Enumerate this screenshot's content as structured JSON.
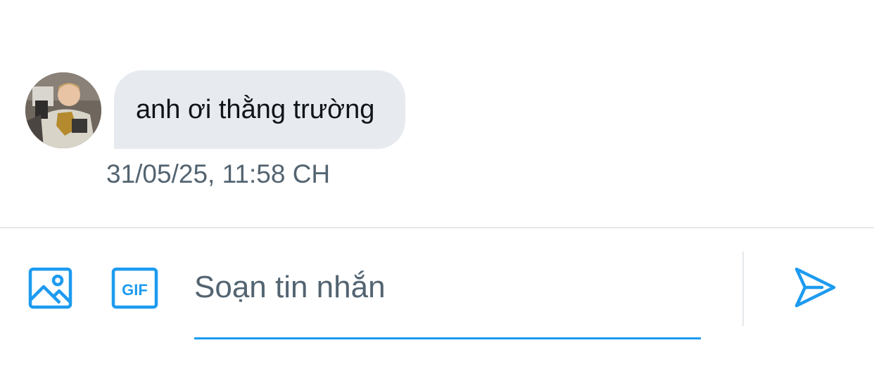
{
  "conversation": {
    "messages": [
      {
        "sender_avatar": "avatar-photo",
        "text": "anh ơi thằng trường",
        "timestamp": "31/05/25, 11:58 CH"
      }
    ]
  },
  "composer": {
    "image_button_icon": "image-icon",
    "gif_button_icon": "gif-icon",
    "gif_label": "GIF",
    "input_placeholder": "Soạn tin nhắn",
    "input_value": "",
    "send_button_icon": "send-icon"
  },
  "colors": {
    "accent": "#1d9bf0",
    "bubble_bg": "#e7ebef",
    "text_primary": "#0f1419",
    "text_secondary": "#536471",
    "divider": "#e6e9ec"
  }
}
